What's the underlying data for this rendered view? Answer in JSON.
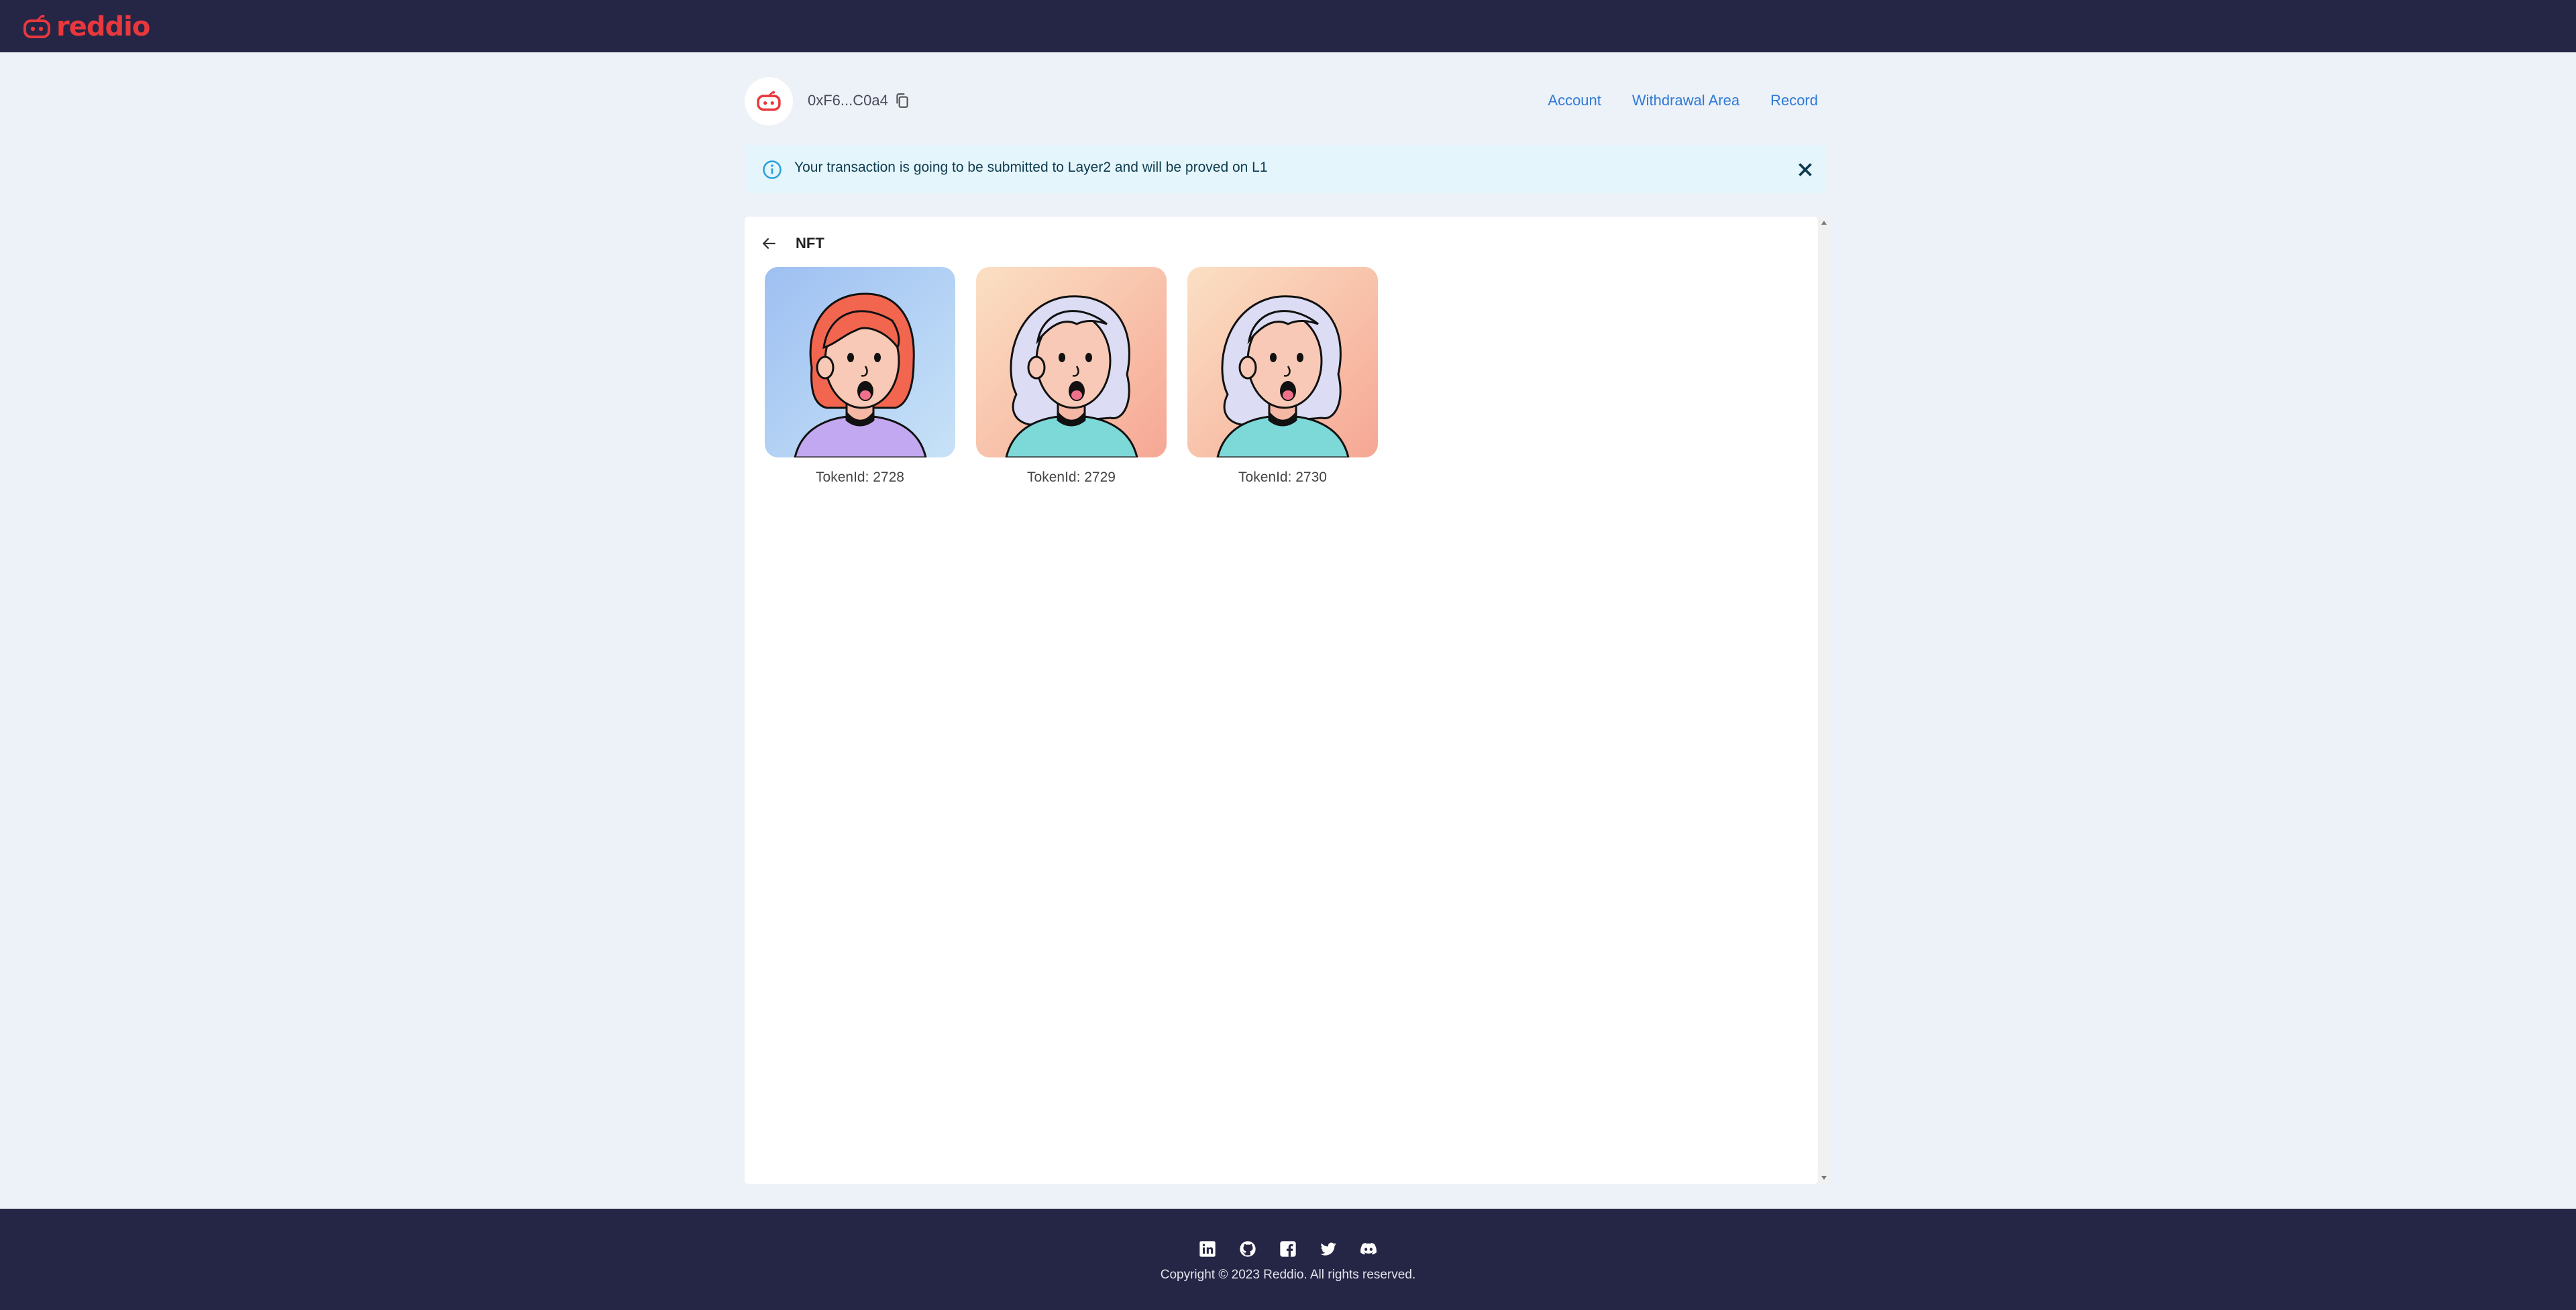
{
  "app": {
    "brand": "reddio",
    "brand_color": "#e8383d",
    "topbar_color": "#252545"
  },
  "header": {
    "wallet_address": "0xF6...C0a4",
    "nav": [
      {
        "label": "Account"
      },
      {
        "label": "Withdrawal Area"
      },
      {
        "label": "Record"
      }
    ]
  },
  "alert": {
    "message": "Your transaction is going to be submitted to Layer2 and will be proved on L1",
    "icon": "info-icon"
  },
  "panel": {
    "title": "NFT",
    "nfts": [
      {
        "label": "TokenId: 2728",
        "bg": [
          "#9ec0f2",
          "#c7e2f7"
        ],
        "hair": "#f2664f",
        "shirt": "#c2a8f0"
      },
      {
        "label": "TokenId: 2729",
        "bg": [
          "#fbe0c4",
          "#f6a794"
        ],
        "hair": "#dcdcf4",
        "shirt": "#7dd8d8"
      },
      {
        "label": "TokenId: 2730",
        "bg": [
          "#fbe0c4",
          "#f6a794"
        ],
        "hair": "#dcdcf4",
        "shirt": "#7dd8d8"
      }
    ]
  },
  "footer": {
    "social_icons": [
      "linkedin-icon",
      "github-icon",
      "facebook-icon",
      "twitter-icon",
      "discord-icon"
    ],
    "copyright": "Copyright © 2023 Reddio. All rights reserved."
  }
}
